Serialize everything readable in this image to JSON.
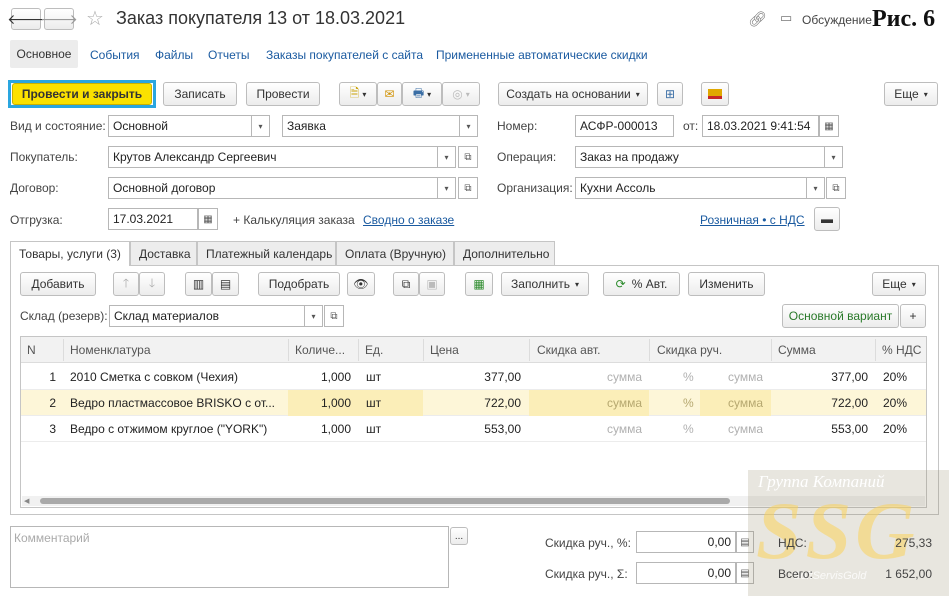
{
  "header": {
    "back_icon": "arrow-left-icon",
    "forward_icon": "arrow-right-icon",
    "star_icon": "star-icon",
    "title": "Заказ покупателя 13 от 18.03.2021",
    "link_icon": "link-icon",
    "discussion_label": "Обсуждение",
    "figure_label": "Рис. 6"
  },
  "nav": {
    "tabs": [
      "Основное",
      "События",
      "Файлы",
      "Отчеты",
      "Заказы покупателей с сайта",
      "Примененные автоматические скидки"
    ]
  },
  "toolbar": {
    "post_close": "Провести и закрыть",
    "save": "Записать",
    "post": "Провести",
    "create_based": "Создать на основании",
    "more": "Еще"
  },
  "form": {
    "kind_label": "Вид и состояние:",
    "kind_value": "Основной",
    "state_value": "Заявка",
    "number_label": "Номер:",
    "number_value": "АСФР-000013",
    "date_label": "от:",
    "date_value": "18.03.2021  9:41:54",
    "buyer_label": "Покупатель:",
    "buyer_value": "Крутов Александр Сергеевич",
    "operation_label": "Операция:",
    "operation_value": "Заказ на продажу",
    "contract_label": "Договор:",
    "contract_value": "Основной договор",
    "org_label": "Организация:",
    "org_value": "Кухни Ассоль",
    "shipment_label": "Отгрузка:",
    "shipment_value": "17.03.2021",
    "calc_label": "+ Калькуляция заказа",
    "summary_link": "Сводно о заказе",
    "price_link": "Розничная • с НДС"
  },
  "tabs": [
    "Товары, услуги (3)",
    "Доставка",
    "Платежный календарь",
    "Оплата (Вручную)",
    "Дополнительно"
  ],
  "goods_toolbar": {
    "add": "Добавить",
    "select": "Подобрать",
    "fill": "Заполнить",
    "auto_percent": "% Авт.",
    "change": "Изменить",
    "more": "Еще"
  },
  "warehouse": {
    "label": "Склад (резерв):",
    "value": "Склад материалов",
    "variant_button": "Основной вариант",
    "plus": "+"
  },
  "table": {
    "columns": [
      "N",
      "Номенклатура",
      "Количе...",
      "Ед.",
      "Цена",
      "Скидка авт.",
      "Скидка руч.",
      "Сумма",
      "% НДС"
    ],
    "rows": [
      {
        "n": "1",
        "name": "2010 Сметка с совком (Чехия)",
        "qty": "1,000",
        "unit": "шт",
        "price": "377,00",
        "disc_auto": "сумма",
        "disc_pct": "%",
        "disc_manual": "сумма",
        "sum": "377,00",
        "vat": "20%"
      },
      {
        "n": "2",
        "name": "Ведро пластмассовое BRISKO с от...",
        "qty": "1,000",
        "unit": "шт",
        "price": "722,00",
        "disc_auto": "сумма",
        "disc_pct": "%",
        "disc_manual": "сумма",
        "sum": "722,00",
        "vat": "20%"
      },
      {
        "n": "3",
        "name": "Ведро с отжимом  круглое (\"YORK\")",
        "qty": "1,000",
        "unit": "шт",
        "price": "553,00",
        "disc_auto": "сумма",
        "disc_pct": "%",
        "disc_manual": "сумма",
        "sum": "553,00",
        "vat": "20%"
      }
    ]
  },
  "footer": {
    "comment_placeholder": "Комментарий",
    "ellipsis": "...",
    "disc_pct_label": "Скидка руч., %:",
    "disc_pct_value": "0,00",
    "disc_sum_label": "Скидка руч., Σ:",
    "disc_sum_value": "0,00",
    "vat_label": "НДС:",
    "vat_value": "275,33",
    "total_label": "Всего:",
    "total_value": "1 652,00"
  },
  "watermark": {
    "line1": "Группа Компаний",
    "logo": "SSG",
    "line2": "SoftServisGold"
  },
  "colors": {
    "accent_yellow": "#fbe100",
    "highlight_border": "#2aa6e0",
    "selected_row": "#fdf6d8",
    "link": "#1a5aa0",
    "green_text": "#2a7a2a"
  }
}
